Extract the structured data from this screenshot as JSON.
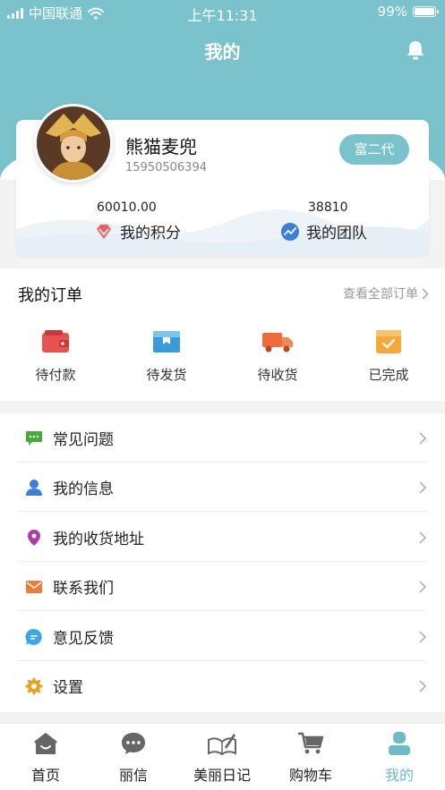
{
  "status_bar": {
    "carrier": "中国联通",
    "time": "上午11:31",
    "battery": "99%",
    "battery_level": 0.99
  },
  "header": {
    "title": "我的",
    "icon": "bell-icon"
  },
  "profile": {
    "name": "熊猫麦兜",
    "phone": "15950506394",
    "badge": "富二代",
    "points_value": "60010.00",
    "points_label": "我的积分",
    "points_icon": "diamond-icon",
    "team_value": "38810",
    "team_label": "我的团队",
    "team_icon": "trend-icon"
  },
  "orders": {
    "title": "我的订单",
    "view_all": "查看全部订单",
    "items": [
      {
        "label": "待付款",
        "icon": "wallet-icon",
        "color": "#e9534f"
      },
      {
        "label": "待发货",
        "icon": "box-icon",
        "color": "#3b9bd8"
      },
      {
        "label": "待收货",
        "icon": "truck-icon",
        "color": "#f06a3a"
      },
      {
        "label": "已完成",
        "icon": "check-box-icon",
        "color": "#f3a93a"
      }
    ]
  },
  "menu": {
    "items": [
      {
        "label": "常见问题",
        "icon": "chat-icon",
        "color": "#3fae3a"
      },
      {
        "label": "我的信息",
        "icon": "user-icon",
        "color": "#3a7fd8"
      },
      {
        "label": "我的收货地址",
        "icon": "location-pin-icon",
        "color": "#b23aa8"
      },
      {
        "label": "联系我们",
        "icon": "mail-icon",
        "color": "#f07a3a"
      },
      {
        "label": "意见反馈",
        "icon": "feedback-icon",
        "color": "#3aa8e8"
      },
      {
        "label": "设置",
        "icon": "gear-icon",
        "color": "#e6a321"
      }
    ]
  },
  "tabbar": {
    "active": "我的",
    "items": [
      {
        "label": "首页",
        "icon": "home-icon"
      },
      {
        "label": "丽信",
        "icon": "message-icon"
      },
      {
        "label": "美丽日记",
        "icon": "diary-icon"
      },
      {
        "label": "购物车",
        "icon": "cart-icon"
      },
      {
        "label": "我的",
        "icon": "profile-icon"
      }
    ]
  },
  "colors": {
    "accent": "#7ac3cc",
    "tab_active": "#6cbcc6"
  }
}
